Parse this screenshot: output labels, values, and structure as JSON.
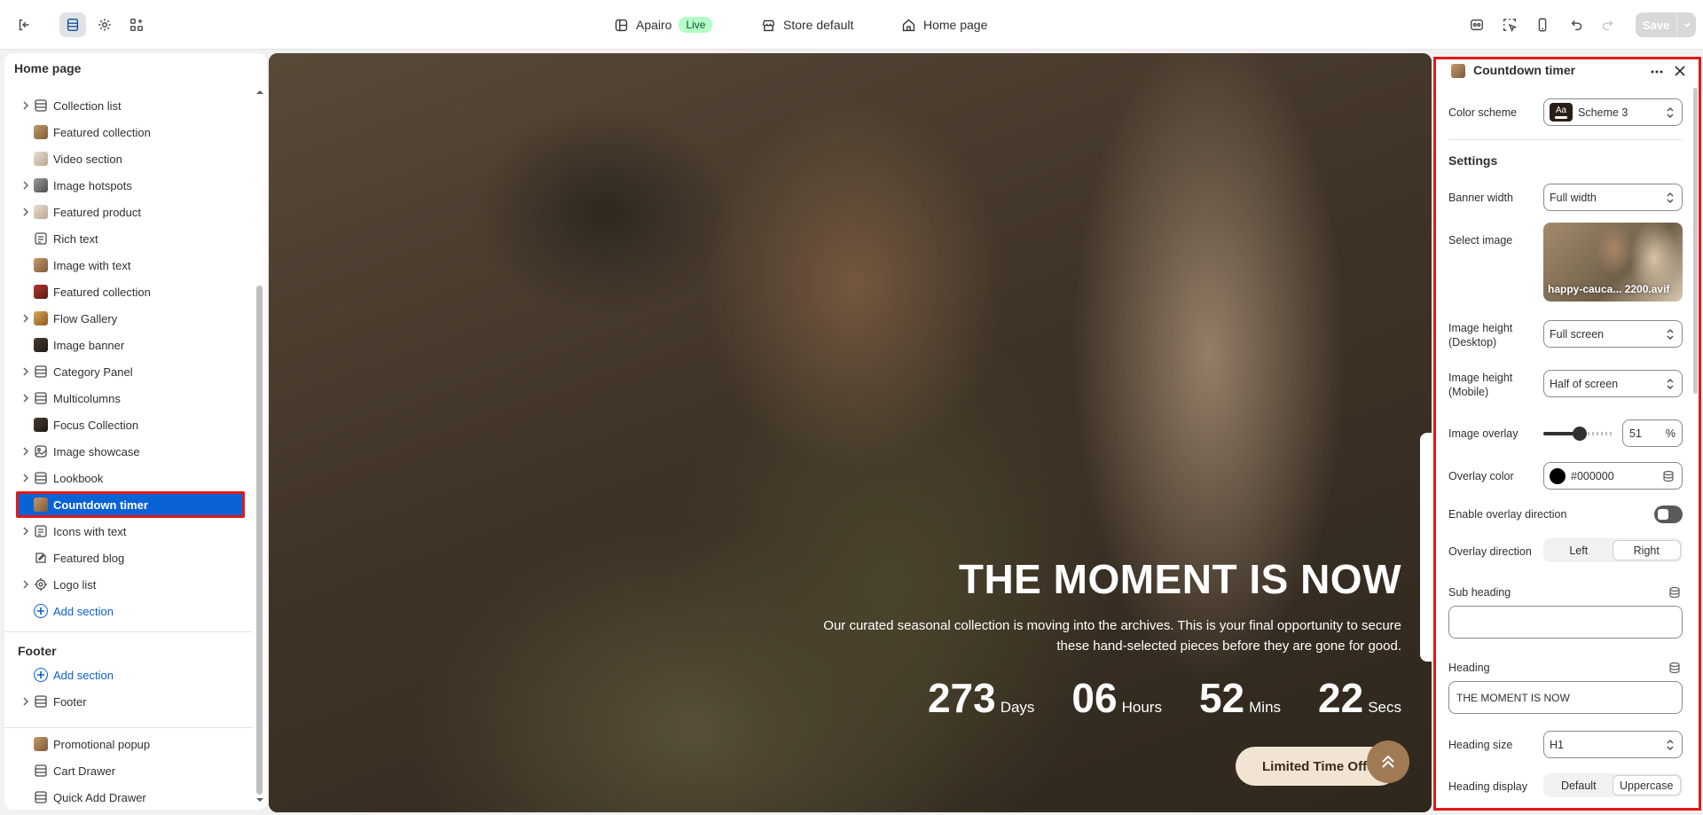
{
  "topbar": {
    "theme_name": "Apairo",
    "live_badge": "Live",
    "store": "Store default",
    "page": "Home page",
    "save_label": "Save"
  },
  "sidebar": {
    "title": "Home page",
    "items": [
      {
        "label": "Collection list",
        "icon": "section-icon",
        "thumb": "",
        "expandable": true
      },
      {
        "label": "Featured collection",
        "icon": "image-thumb",
        "thumb": "warm",
        "expandable": false
      },
      {
        "label": "Video section",
        "icon": "image-thumb",
        "thumb": "light",
        "expandable": false
      },
      {
        "label": "Image hotspots",
        "icon": "image-thumb",
        "thumb": "gray",
        "expandable": true
      },
      {
        "label": "Featured product",
        "icon": "image-thumb",
        "thumb": "light",
        "expandable": true
      },
      {
        "label": "Rich text",
        "icon": "text-icon",
        "thumb": "",
        "expandable": false
      },
      {
        "label": "Image with text",
        "icon": "image-thumb",
        "thumb": "warm",
        "expandable": false
      },
      {
        "label": "Featured collection",
        "icon": "image-thumb",
        "thumb": "red",
        "expandable": false
      },
      {
        "label": "Flow Gallery",
        "icon": "image-thumb",
        "thumb": "gold",
        "expandable": true
      },
      {
        "label": "Image banner",
        "icon": "image-thumb",
        "thumb": "dark",
        "expandable": false
      },
      {
        "label": "Category Panel",
        "icon": "section-icon",
        "thumb": "",
        "expandable": true
      },
      {
        "label": "Multicolumns",
        "icon": "section-icon",
        "thumb": "",
        "expandable": true
      },
      {
        "label": "Focus Collection",
        "icon": "image-thumb",
        "thumb": "dark",
        "expandable": false
      },
      {
        "label": "Image showcase",
        "icon": "showcase-icon",
        "thumb": "",
        "expandable": true
      },
      {
        "label": "Lookbook",
        "icon": "section-icon",
        "thumb": "",
        "expandable": true
      },
      {
        "label": "Countdown timer",
        "icon": "image-thumb",
        "thumb": "warm",
        "expandable": false,
        "selected": true
      },
      {
        "label": "Icons with text",
        "icon": "text-icon",
        "thumb": "",
        "expandable": true
      },
      {
        "label": "Featured blog",
        "icon": "blog-icon",
        "thumb": "",
        "expandable": false
      },
      {
        "label": "Logo list",
        "icon": "logo-icon",
        "thumb": "",
        "expandable": true
      }
    ],
    "add_section": "Add section",
    "footer_group": "Footer",
    "footer_add_section": "Add section",
    "footer_item": "Footer",
    "overlays": [
      {
        "label": "Promotional popup",
        "thumb": "warm"
      },
      {
        "label": "Cart Drawer",
        "icon": "section-icon"
      },
      {
        "label": "Quick Add Drawer",
        "icon": "section-icon"
      }
    ]
  },
  "preview": {
    "heading": "THE MOMENT IS NOW",
    "text": "Our curated seasonal collection is moving into the archives. This is your final opportunity to secure these hand-selected pieces before they are gone for good.",
    "countdown": [
      {
        "value": "273",
        "label": "Days"
      },
      {
        "value": "06",
        "label": "Hours"
      },
      {
        "value": "52",
        "label": "Mins"
      },
      {
        "value": "22",
        "label": "Secs"
      }
    ],
    "button": "Limited Time Offer"
  },
  "panel": {
    "title": "Countdown timer",
    "color_scheme_label": "Color scheme",
    "color_scheme_chip": "Aa",
    "color_scheme_value": "Scheme 3",
    "settings_heading": "Settings",
    "banner_width_label": "Banner width",
    "banner_width_value": "Full width",
    "select_image_label": "Select image",
    "image_filename": "happy-cauca... 2200.avif",
    "image_height_desktop_label": "Image height (Desktop)",
    "image_height_desktop_value": "Full screen",
    "image_height_mobile_label": "Image height (Mobile)",
    "image_height_mobile_value": "Half of screen",
    "image_overlay_label": "Image overlay",
    "image_overlay_value": "51",
    "image_overlay_unit": "%",
    "image_overlay_level": 0.51,
    "overlay_color_label": "Overlay color",
    "overlay_color_value": "#000000",
    "enable_overlay_direction_label": "Enable overlay direction",
    "overlay_direction_label": "Overlay direction",
    "overlay_direction_options": [
      "Left",
      "Right"
    ],
    "overlay_direction_selected": "Right",
    "sub_heading_label": "Sub heading",
    "sub_heading_value": "",
    "heading_label": "Heading",
    "heading_value": "THE MOMENT IS NOW",
    "heading_size_label": "Heading size",
    "heading_size_value": "H1",
    "heading_display_label": "Heading display",
    "heading_display_options": [
      "Default",
      "Uppercase"
    ],
    "heading_display_selected": "Uppercase"
  }
}
